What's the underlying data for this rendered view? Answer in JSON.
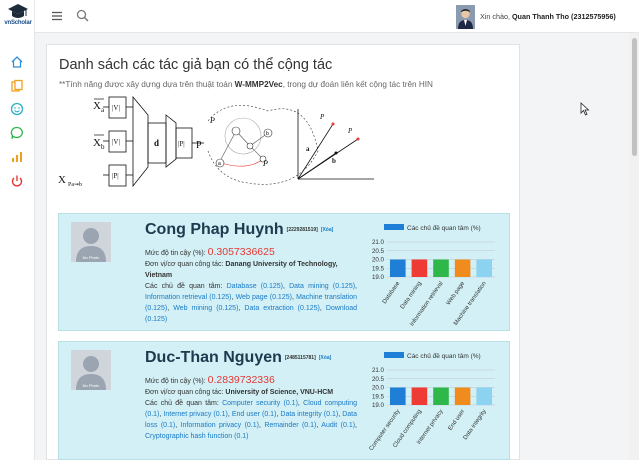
{
  "app": {
    "logo_text": "vnScholar",
    "user_greeting_prefix": "Xin chào, ",
    "user_name": "Quan Thanh Tho (2312575956)"
  },
  "sidebar": {
    "items": [
      {
        "icon": "home-icon"
      },
      {
        "icon": "documents-icon"
      },
      {
        "icon": "smiley-icon"
      },
      {
        "icon": "chat-icon"
      },
      {
        "icon": "bar-chart-icon"
      },
      {
        "icon": "power-icon"
      }
    ]
  },
  "colors": {
    "accent": "#1a7ac7",
    "sidebar_icon": "#2f8fd8",
    "power_icon": "#e53935",
    "entry_bg": "#d2f0f5",
    "confidence": "#e53935"
  },
  "page": {
    "title": "Danh sách các tác giả bạn có thể cộng tác",
    "note_prefix": "**Tính năng được xây dựng dựa trên thuật toán ",
    "note_algo": "W-MMP2Vec",
    "note_suffix": ", trong dự đoán liên kết cộng tác trên HIN"
  },
  "diagram": {
    "xa": "X",
    "xa_sub": "a",
    "xb": "X",
    "xb_sub": "b",
    "xp": "X",
    "v_box": "|V|",
    "p_box": "|P|",
    "d_box": "d",
    "p_out": "|P|",
    "label_a": "a",
    "label_b": "b"
  },
  "labels": {
    "confidence": "Mức độ tin cậy (%): ",
    "workplace": "Đơn vị/cơ quan công tác: ",
    "topics": "Các chủ đề quan tâm: ",
    "delete": "[Xóa]",
    "no_photo": "No Photo"
  },
  "authors": [
    {
      "name": "Cong Phap Huynh",
      "id": "[2229281519]",
      "confidence": "0.3057336625",
      "workplace": "Danang University of Technology, Vietnam",
      "topics": [
        "Database (0.125)",
        "Data mining (0.125)",
        "Information retrieval (0.125)",
        "Web page (0.125)",
        "Machine translation (0.125)",
        "Web mining (0.125)",
        "Data extraction (0.125)",
        "Download (0.125)"
      ],
      "chart_data": {
        "type": "bar",
        "legend": [
          "Các chủ đề quan tâm (%)"
        ],
        "categories": [
          "Database",
          "Data mining",
          "Information retrieval",
          "Web page",
          "Machine translation"
        ],
        "values": [
          20.0,
          20.0,
          20.0,
          20.0,
          20.0
        ],
        "colors": [
          "#1f7fd6",
          "#ef3b36",
          "#2fb84a",
          "#f08c1e",
          "#8bd3f0"
        ],
        "yticks": [
          "21.0",
          "20.5",
          "20.0",
          "19.5",
          "19.0"
        ],
        "ylim": [
          19.0,
          21.0
        ]
      }
    },
    {
      "name": "Duc-Than Nguyen",
      "id": "[2485115781]",
      "confidence": "0.2839732336",
      "workplace": "University of Science, VNU-HCM",
      "topics": [
        "Computer security (0.1)",
        "Cloud computing (0.1)",
        "Internet privacy (0.1)",
        "End user (0.1)",
        "Data integrity (0.1)",
        "Data loss (0.1)",
        "Information privacy (0.1)",
        "Remainder (0.1)",
        "Audit (0.1)",
        "Cryptographic hash function (0.1)"
      ],
      "chart_data": {
        "type": "bar",
        "legend": [
          "Các chủ đề quan tâm (%)"
        ],
        "categories": [
          "Computer security",
          "Cloud computing",
          "Internet privacy",
          "End user",
          "Data integrity"
        ],
        "values": [
          20.0,
          20.0,
          20.0,
          20.0,
          20.0
        ],
        "colors": [
          "#1f7fd6",
          "#ef3b36",
          "#2fb84a",
          "#f08c1e",
          "#8bd3f0"
        ],
        "yticks": [
          "21.0",
          "20.5",
          "20.0",
          "19.5",
          "19.0"
        ],
        "ylim": [
          19.0,
          21.0
        ]
      }
    }
  ]
}
